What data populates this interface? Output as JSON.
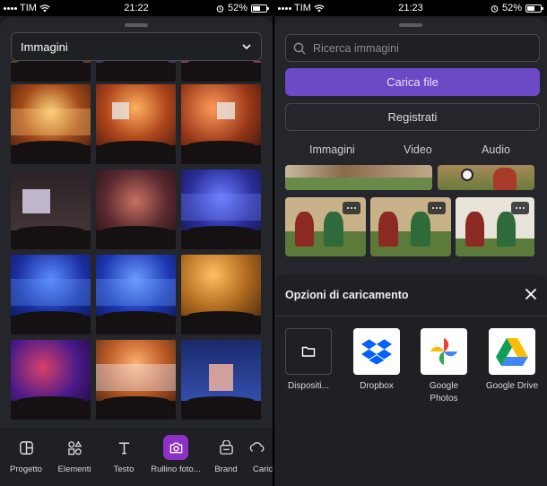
{
  "left_screen": {
    "status": {
      "carrier": "TIM",
      "time": "21:22",
      "battery": "52%"
    },
    "dropdown": {
      "label": "Immagini",
      "icon": "chevron-down-icon"
    },
    "bottom_nav": [
      {
        "label": "Progetto",
        "icon": "layout-icon"
      },
      {
        "label": "Elementi",
        "icon": "shapes-icon"
      },
      {
        "label": "Testo",
        "icon": "text-icon"
      },
      {
        "label": "Rullino foto...",
        "icon": "camera-icon",
        "active": true
      },
      {
        "label": "Brand",
        "icon": "brand-icon"
      },
      {
        "label": "Caric",
        "icon": "upload-icon"
      }
    ]
  },
  "right_screen": {
    "status": {
      "carrier": "TIM",
      "time": "21:23",
      "battery": "52%"
    },
    "search": {
      "placeholder": "Ricerca immagini",
      "icon": "search-icon"
    },
    "upload_button": "Carica file",
    "record_button": "Registrati",
    "media_tabs": [
      "Immagini",
      "Video",
      "Audio"
    ],
    "upload_sheet": {
      "title": "Opzioni di caricamento",
      "close_icon": "close-icon",
      "options": [
        {
          "label": "Dispositi...",
          "icon": "folder-icon"
        },
        {
          "label": "Dropbox",
          "icon": "dropbox-icon"
        },
        {
          "label": "Google Photos",
          "icon": "google-photos-icon"
        },
        {
          "label": "Google Drive",
          "icon": "google-drive-icon"
        }
      ]
    }
  },
  "colors": {
    "sheet_bg": "#25262b",
    "primary_button": "#6c49c5",
    "active_tab": "#8e2fc5",
    "dropbox_blue": "#0061fe"
  }
}
